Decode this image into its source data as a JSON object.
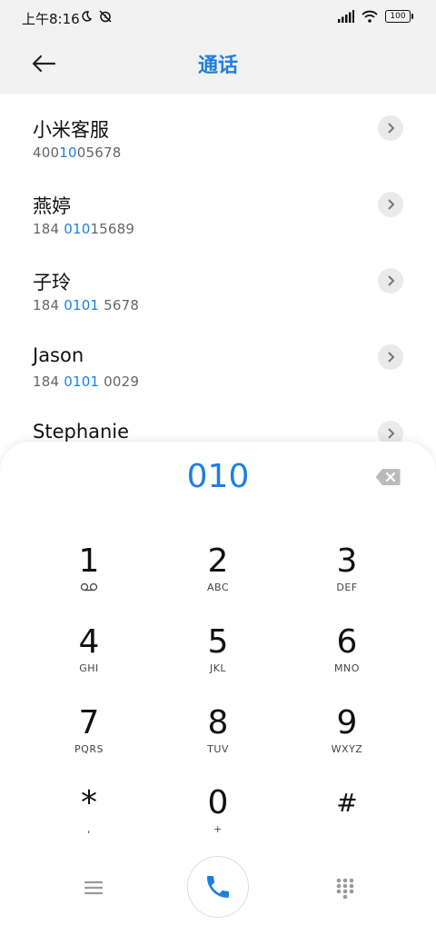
{
  "status_bar": {
    "time": "上午8:16",
    "battery": "100"
  },
  "header": {
    "title": "通话"
  },
  "contacts": [
    {
      "name": "小米客服",
      "number_pre": "400",
      "number_hl": "10",
      "number_post": "05678"
    },
    {
      "name": "燕婷",
      "number_pre": "184 ",
      "number_hl": "010",
      "number_post": "15689"
    },
    {
      "name": "子玲",
      "number_pre": "184 ",
      "number_hl": "0101",
      "number_post": " 5678"
    },
    {
      "name": "Jason",
      "number_pre": "184 ",
      "number_hl": "0101",
      "number_post": " 0029"
    },
    {
      "name": "Stephanie",
      "number_pre": "",
      "number_hl": "",
      "number_post": ""
    }
  ],
  "dialpad": {
    "input": "010",
    "keys": [
      {
        "digit": "1",
        "letters": ""
      },
      {
        "digit": "2",
        "letters": "ABC"
      },
      {
        "digit": "3",
        "letters": "DEF"
      },
      {
        "digit": "4",
        "letters": "GHI"
      },
      {
        "digit": "5",
        "letters": "JKL"
      },
      {
        "digit": "6",
        "letters": "MNO"
      },
      {
        "digit": "7",
        "letters": "PQRS"
      },
      {
        "digit": "8",
        "letters": "TUV"
      },
      {
        "digit": "9",
        "letters": "WXYZ"
      },
      {
        "digit": "*",
        "letters": ","
      },
      {
        "digit": "0",
        "letters": "+"
      },
      {
        "digit": "#",
        "letters": ""
      }
    ]
  },
  "colors": {
    "accent": "#1f7fe0",
    "header_bg": "#f2f2f2"
  },
  "icons": {
    "back": "arrow-left",
    "detail": "chevron-right",
    "delete": "backspace",
    "voicemail": "voicemail",
    "menu": "hamburger-menu",
    "call": "phone",
    "keypad": "dialpad-grid"
  }
}
